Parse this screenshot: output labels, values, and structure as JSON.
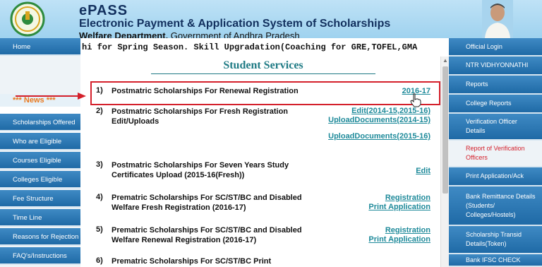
{
  "header": {
    "brand_title": "ePASS",
    "brand_subtitle": "Electronic  Payment & Application System of Scholarships",
    "dept_label": "Welfare Department,",
    "gov_label": " Government of Andhra Pradesh"
  },
  "ticker": {
    "text": "hi for Spring Season.          Skill Upgradation(Coaching for GRE,TOFEL,GMA"
  },
  "left_sidebar": {
    "home": "Home",
    "news": "*** News ***",
    "items": [
      "Scholarships Offered",
      "Who are Eligible",
      "Courses Eligible",
      "Colleges Eligible",
      "Fee Structure",
      "Time Line",
      "Reasons for Rejection",
      "FAQ's/Instructions"
    ]
  },
  "main": {
    "title": "Student Services",
    "services": [
      {
        "num": "1)",
        "text": "Postmatric Scholarships For Renewal Registration",
        "links": [
          "2016-17"
        ]
      },
      {
        "num": "2)",
        "text": "Postmatric Scholarships For Fresh Registration Edit/Uploads",
        "links": [
          "Edit(2014-15,2015-16)",
          "UploadDocuments(2014-15)",
          "UploadDocuments(2015-16)"
        ]
      },
      {
        "num": "3)",
        "text": "Postmatric Scholarships For Seven Years Study Certificates Upload (2015-16(Fresh))",
        "links": [
          "Edit"
        ]
      },
      {
        "num": "4)",
        "text": "Prematric Scholarships For SC/ST/BC and Disabled Welfare Fresh Registration (2016-17)",
        "links": [
          "Registration",
          "Print Application"
        ]
      },
      {
        "num": "5)",
        "text": "Prematric Scholarships For SC/ST/BC and Disabled Welfare Renewal Registration (2016-17)",
        "links": [
          "Registration",
          "Print Application"
        ]
      },
      {
        "num": "6)",
        "text": "Prematric Scholarships For SC/ST/BC Print",
        "links": []
      }
    ]
  },
  "right_sidebar": {
    "items": [
      "Official Login",
      "NTR VIDHYONNATHI",
      "Reports",
      "College Reports",
      "Verification Officer Details",
      "Report of Verification Officers",
      "Print Application/Ack",
      "Bank Remittance Details (Students/ Colleges/Hostels)",
      "Scholarship Transid Details(Token)",
      "Bank IFSC CHECK"
    ]
  },
  "colors": {
    "nav_blue": "#2a78b6",
    "link_teal": "#1e8a9a",
    "highlight_red": "#d4202b",
    "news_orange": "#e8791f"
  },
  "icons": [
    "ap-government-emblem",
    "leader-portrait",
    "red-arrow",
    "hand-cursor-icon"
  ]
}
